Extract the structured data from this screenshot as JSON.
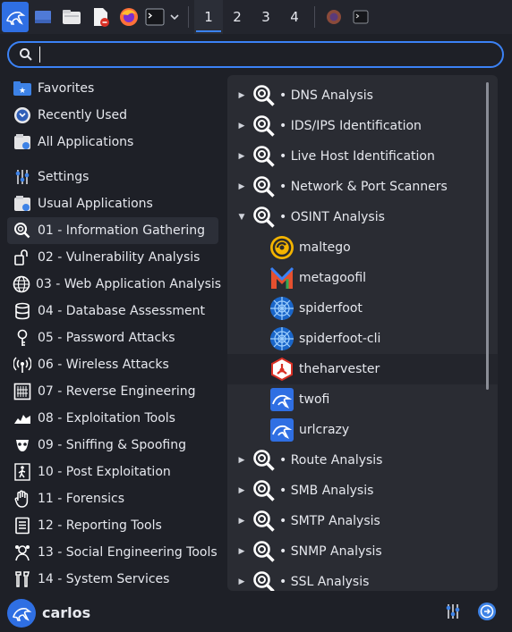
{
  "panel": {
    "workspaces": [
      "1",
      "2",
      "3",
      "4"
    ],
    "active_workspace": "1",
    "launchers": [
      "kali-menu-icon",
      "desktop-icon",
      "file-manager-icon",
      "text-editor-icon",
      "firefox-icon",
      "terminal-icon"
    ]
  },
  "search": {
    "value": "",
    "placeholder": ""
  },
  "sidebar": {
    "top": [
      {
        "label": "Favorites",
        "icon": "star-folder-icon"
      },
      {
        "label": "Recently Used",
        "icon": "clock-icon"
      },
      {
        "label": "All Applications",
        "icon": "applications-icon"
      }
    ],
    "categories": [
      {
        "label": "Settings",
        "icon": "settings-sliders-icon"
      },
      {
        "label": "Usual Applications",
        "icon": "applications-icon"
      },
      {
        "label": "01 - Information Gathering",
        "icon": "magnifier-icon",
        "selected": true
      },
      {
        "label": "02 - Vulnerability Analysis",
        "icon": "vulnerability-icon"
      },
      {
        "label": "03 - Web Application Analysis",
        "icon": "globe-icon"
      },
      {
        "label": "04 - Database Assessment",
        "icon": "database-icon"
      },
      {
        "label": "05 - Password Attacks",
        "icon": "key-icon"
      },
      {
        "label": "06 - Wireless Attacks",
        "icon": "wireless-icon"
      },
      {
        "label": "07 - Reverse Engineering",
        "icon": "chip-icon"
      },
      {
        "label": "08 - Exploitation Tools",
        "icon": "exploit-icon"
      },
      {
        "label": "09 - Sniffing & Spoofing",
        "icon": "mask-icon"
      },
      {
        "label": "10 - Post Exploitation",
        "icon": "runner-icon"
      },
      {
        "label": "11 - Forensics",
        "icon": "hand-icon"
      },
      {
        "label": "12 - Reporting Tools",
        "icon": "document-icon"
      },
      {
        "label": "13 - Social Engineering Tools",
        "icon": "social-icon"
      },
      {
        "label": "14 - System Services",
        "icon": "tools-icon"
      }
    ]
  },
  "apps": {
    "groups_before": [
      {
        "label": "• DNS Analysis"
      },
      {
        "label": "• IDS/IPS Identification"
      },
      {
        "label": "• Live Host Identification"
      },
      {
        "label": "• Network & Port Scanners"
      }
    ],
    "expanded_group": {
      "label": "• OSINT Analysis"
    },
    "items": [
      {
        "label": "maltego",
        "icon": "maltego-icon"
      },
      {
        "label": "metagoofil",
        "icon": "metagoofil-icon"
      },
      {
        "label": "spiderfoot",
        "icon": "spiderfoot-icon"
      },
      {
        "label": "spiderfoot-cli",
        "icon": "spiderfoot-icon"
      },
      {
        "label": "theharvester",
        "icon": "theharvester-icon",
        "highlighted": true
      },
      {
        "label": "twofi",
        "icon": "kali-dragon-icon"
      },
      {
        "label": "urlcrazy",
        "icon": "kali-dragon-icon"
      }
    ],
    "groups_after": [
      {
        "label": "• Route Analysis"
      },
      {
        "label": "• SMB Analysis"
      },
      {
        "label": "• SMTP Analysis"
      },
      {
        "label": "• SNMP Analysis"
      },
      {
        "label": "• SSL Analysis"
      }
    ]
  },
  "footer": {
    "username": "carlos"
  },
  "colors": {
    "accent": "#3b82f6",
    "background": "#1e2027",
    "panel": "#2a2c33"
  }
}
